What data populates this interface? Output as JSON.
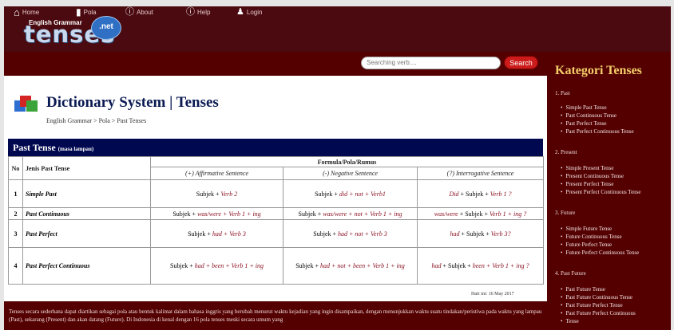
{
  "logo": {
    "subtitle": "English Grammar",
    "word": "tenses",
    "badge": ".net"
  },
  "nav": {
    "home": "Home",
    "pola": "Pola",
    "about": "About",
    "help": "Help",
    "login": "Login"
  },
  "search": {
    "placeholder": "Searching verb....",
    "button": "Search"
  },
  "page": {
    "title": "Dictionary System | Tenses",
    "breadcrumb": "English Grammar > Pola > Past Tenses",
    "section": "Past Tense",
    "section_note": "(masa lampau)"
  },
  "table": {
    "col_no": "No",
    "col_name": "Jenis Past Tense",
    "col_formula": "Formula/Pola/Rumus",
    "col_aff": "(+) Affirmative Sentence",
    "col_neg": "(-) Negative Sentence",
    "col_int": "(?) Interrogative Sentence",
    "rows": [
      {
        "no": "1",
        "name": "Simple Past",
        "aff_a": "Subjek + ",
        "aff_b": "Verb 2",
        "neg_a": "Subjek + ",
        "neg_b": "did + not + Verb1",
        "int_a": "Did",
        "int_b": " + Subjek + ",
        "int_c": "Verb 1 ?"
      },
      {
        "no": "2",
        "name": "Past Continuous",
        "aff_a": "Subjek + ",
        "aff_b": "was/were + Verb 1 + ing",
        "neg_a": "Subjek + ",
        "neg_b": "was/were + not + Verb 1 + ing",
        "int_a": "was/were",
        "int_b": " + Subjek + ",
        "int_c": "Verb 1 + ing ?"
      },
      {
        "no": "3",
        "name": "Past Perfect",
        "aff_a": "Subjek + ",
        "aff_b": "had + Verb 3",
        "neg_a": "Subjek + ",
        "neg_b": "had + not + Verb 3",
        "int_a": "had",
        "int_b": " + Subjek + ",
        "int_c": "Verb 3?"
      },
      {
        "no": "4",
        "name": "Past Perfect Continuous",
        "aff_a": "Subjek + ",
        "aff_b": "had + been + Verb 1 + ing",
        "neg_a": "Subjek + ",
        "neg_b": "had + not + been + Verb 1 + ing",
        "int_a": "had",
        "int_b": " + Subjek + ",
        "int_c": "been + Verb 1 + ing ?"
      }
    ]
  },
  "date": "Hari ini: 16 May 2017",
  "footer": "Tenses secara sederhana dapat diartikan sebagai pola atau bentuk kalimat dalam bahasa inggris yang berubah menurut waktu kejadian yang ingin disampaikan, dengan menunjukkan waktu suatu tindakan/peristiwa pada waktu yang lampau (Past), sekarang (Present) dan akan datang (Future). Di Indonesia di kenal dengan 16 pola tenses meski secara umum yang",
  "sidebar": {
    "title": "Kategori Tenses",
    "categories": [
      {
        "label": "1. Past",
        "items": [
          "Simple Past Tense",
          "Past Continuous Tense",
          "Past Perfect Tense",
          "Past Perfect Continuous Tense"
        ]
      },
      {
        "label": "2. Present",
        "items": [
          "Simple Present Tense",
          "Present Continuous Tense",
          "Present Perfect Tense",
          "Present Perfect Continuous Tense"
        ]
      },
      {
        "label": "3. Future",
        "items": [
          "Simple Future Tense",
          "Future Continuous Tense",
          "Future Perfect Tense",
          "Future Perfect Continuous Tense"
        ]
      },
      {
        "label": "4. Past Future",
        "items": [
          "Past Future Tense",
          "Past Future Continuous Tense",
          "Past Future Perfect Tense",
          "Past Future Perfect Continuous",
          "Tense"
        ]
      }
    ]
  },
  "colors": {
    "maroon": "#540000",
    "navy": "#000850",
    "accent_red": "#cc1b1b",
    "title_gold": "#f3cf6a"
  }
}
